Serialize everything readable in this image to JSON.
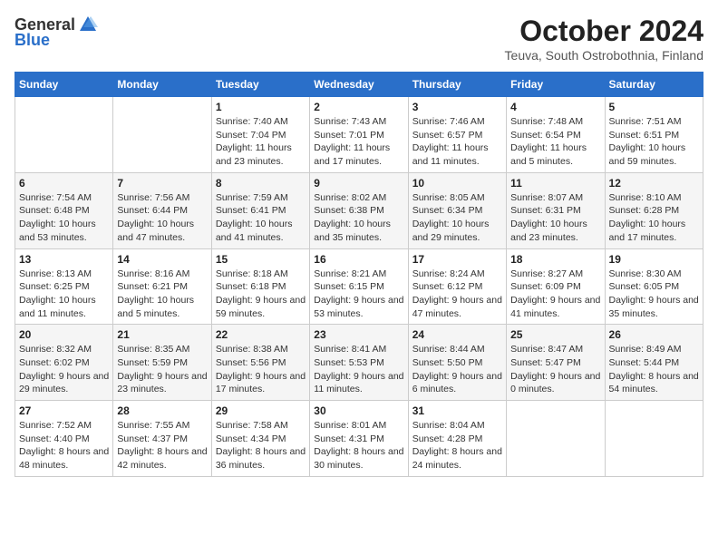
{
  "logo": {
    "general": "General",
    "blue": "Blue",
    "tagline": ""
  },
  "header": {
    "month": "October 2024",
    "location": "Teuva, South Ostrobothnia, Finland"
  },
  "weekdays": [
    "Sunday",
    "Monday",
    "Tuesday",
    "Wednesday",
    "Thursday",
    "Friday",
    "Saturday"
  ],
  "weeks": [
    [
      null,
      null,
      {
        "day": "1",
        "sunrise": "Sunrise: 7:40 AM",
        "sunset": "Sunset: 7:04 PM",
        "daylight": "Daylight: 11 hours and 23 minutes."
      },
      {
        "day": "2",
        "sunrise": "Sunrise: 7:43 AM",
        "sunset": "Sunset: 7:01 PM",
        "daylight": "Daylight: 11 hours and 17 minutes."
      },
      {
        "day": "3",
        "sunrise": "Sunrise: 7:46 AM",
        "sunset": "Sunset: 6:57 PM",
        "daylight": "Daylight: 11 hours and 11 minutes."
      },
      {
        "day": "4",
        "sunrise": "Sunrise: 7:48 AM",
        "sunset": "Sunset: 6:54 PM",
        "daylight": "Daylight: 11 hours and 5 minutes."
      },
      {
        "day": "5",
        "sunrise": "Sunrise: 7:51 AM",
        "sunset": "Sunset: 6:51 PM",
        "daylight": "Daylight: 10 hours and 59 minutes."
      }
    ],
    [
      {
        "day": "6",
        "sunrise": "Sunrise: 7:54 AM",
        "sunset": "Sunset: 6:48 PM",
        "daylight": "Daylight: 10 hours and 53 minutes."
      },
      {
        "day": "7",
        "sunrise": "Sunrise: 7:56 AM",
        "sunset": "Sunset: 6:44 PM",
        "daylight": "Daylight: 10 hours and 47 minutes."
      },
      {
        "day": "8",
        "sunrise": "Sunrise: 7:59 AM",
        "sunset": "Sunset: 6:41 PM",
        "daylight": "Daylight: 10 hours and 41 minutes."
      },
      {
        "day": "9",
        "sunrise": "Sunrise: 8:02 AM",
        "sunset": "Sunset: 6:38 PM",
        "daylight": "Daylight: 10 hours and 35 minutes."
      },
      {
        "day": "10",
        "sunrise": "Sunrise: 8:05 AM",
        "sunset": "Sunset: 6:34 PM",
        "daylight": "Daylight: 10 hours and 29 minutes."
      },
      {
        "day": "11",
        "sunrise": "Sunrise: 8:07 AM",
        "sunset": "Sunset: 6:31 PM",
        "daylight": "Daylight: 10 hours and 23 minutes."
      },
      {
        "day": "12",
        "sunrise": "Sunrise: 8:10 AM",
        "sunset": "Sunset: 6:28 PM",
        "daylight": "Daylight: 10 hours and 17 minutes."
      }
    ],
    [
      {
        "day": "13",
        "sunrise": "Sunrise: 8:13 AM",
        "sunset": "Sunset: 6:25 PM",
        "daylight": "Daylight: 10 hours and 11 minutes."
      },
      {
        "day": "14",
        "sunrise": "Sunrise: 8:16 AM",
        "sunset": "Sunset: 6:21 PM",
        "daylight": "Daylight: 10 hours and 5 minutes."
      },
      {
        "day": "15",
        "sunrise": "Sunrise: 8:18 AM",
        "sunset": "Sunset: 6:18 PM",
        "daylight": "Daylight: 9 hours and 59 minutes."
      },
      {
        "day": "16",
        "sunrise": "Sunrise: 8:21 AM",
        "sunset": "Sunset: 6:15 PM",
        "daylight": "Daylight: 9 hours and 53 minutes."
      },
      {
        "day": "17",
        "sunrise": "Sunrise: 8:24 AM",
        "sunset": "Sunset: 6:12 PM",
        "daylight": "Daylight: 9 hours and 47 minutes."
      },
      {
        "day": "18",
        "sunrise": "Sunrise: 8:27 AM",
        "sunset": "Sunset: 6:09 PM",
        "daylight": "Daylight: 9 hours and 41 minutes."
      },
      {
        "day": "19",
        "sunrise": "Sunrise: 8:30 AM",
        "sunset": "Sunset: 6:05 PM",
        "daylight": "Daylight: 9 hours and 35 minutes."
      }
    ],
    [
      {
        "day": "20",
        "sunrise": "Sunrise: 8:32 AM",
        "sunset": "Sunset: 6:02 PM",
        "daylight": "Daylight: 9 hours and 29 minutes."
      },
      {
        "day": "21",
        "sunrise": "Sunrise: 8:35 AM",
        "sunset": "Sunset: 5:59 PM",
        "daylight": "Daylight: 9 hours and 23 minutes."
      },
      {
        "day": "22",
        "sunrise": "Sunrise: 8:38 AM",
        "sunset": "Sunset: 5:56 PM",
        "daylight": "Daylight: 9 hours and 17 minutes."
      },
      {
        "day": "23",
        "sunrise": "Sunrise: 8:41 AM",
        "sunset": "Sunset: 5:53 PM",
        "daylight": "Daylight: 9 hours and 11 minutes."
      },
      {
        "day": "24",
        "sunrise": "Sunrise: 8:44 AM",
        "sunset": "Sunset: 5:50 PM",
        "daylight": "Daylight: 9 hours and 6 minutes."
      },
      {
        "day": "25",
        "sunrise": "Sunrise: 8:47 AM",
        "sunset": "Sunset: 5:47 PM",
        "daylight": "Daylight: 9 hours and 0 minutes."
      },
      {
        "day": "26",
        "sunrise": "Sunrise: 8:49 AM",
        "sunset": "Sunset: 5:44 PM",
        "daylight": "Daylight: 8 hours and 54 minutes."
      }
    ],
    [
      {
        "day": "27",
        "sunrise": "Sunrise: 7:52 AM",
        "sunset": "Sunset: 4:40 PM",
        "daylight": "Daylight: 8 hours and 48 minutes."
      },
      {
        "day": "28",
        "sunrise": "Sunrise: 7:55 AM",
        "sunset": "Sunset: 4:37 PM",
        "daylight": "Daylight: 8 hours and 42 minutes."
      },
      {
        "day": "29",
        "sunrise": "Sunrise: 7:58 AM",
        "sunset": "Sunset: 4:34 PM",
        "daylight": "Daylight: 8 hours and 36 minutes."
      },
      {
        "day": "30",
        "sunrise": "Sunrise: 8:01 AM",
        "sunset": "Sunset: 4:31 PM",
        "daylight": "Daylight: 8 hours and 30 minutes."
      },
      {
        "day": "31",
        "sunrise": "Sunrise: 8:04 AM",
        "sunset": "Sunset: 4:28 PM",
        "daylight": "Daylight: 8 hours and 24 minutes."
      },
      null,
      null
    ]
  ]
}
